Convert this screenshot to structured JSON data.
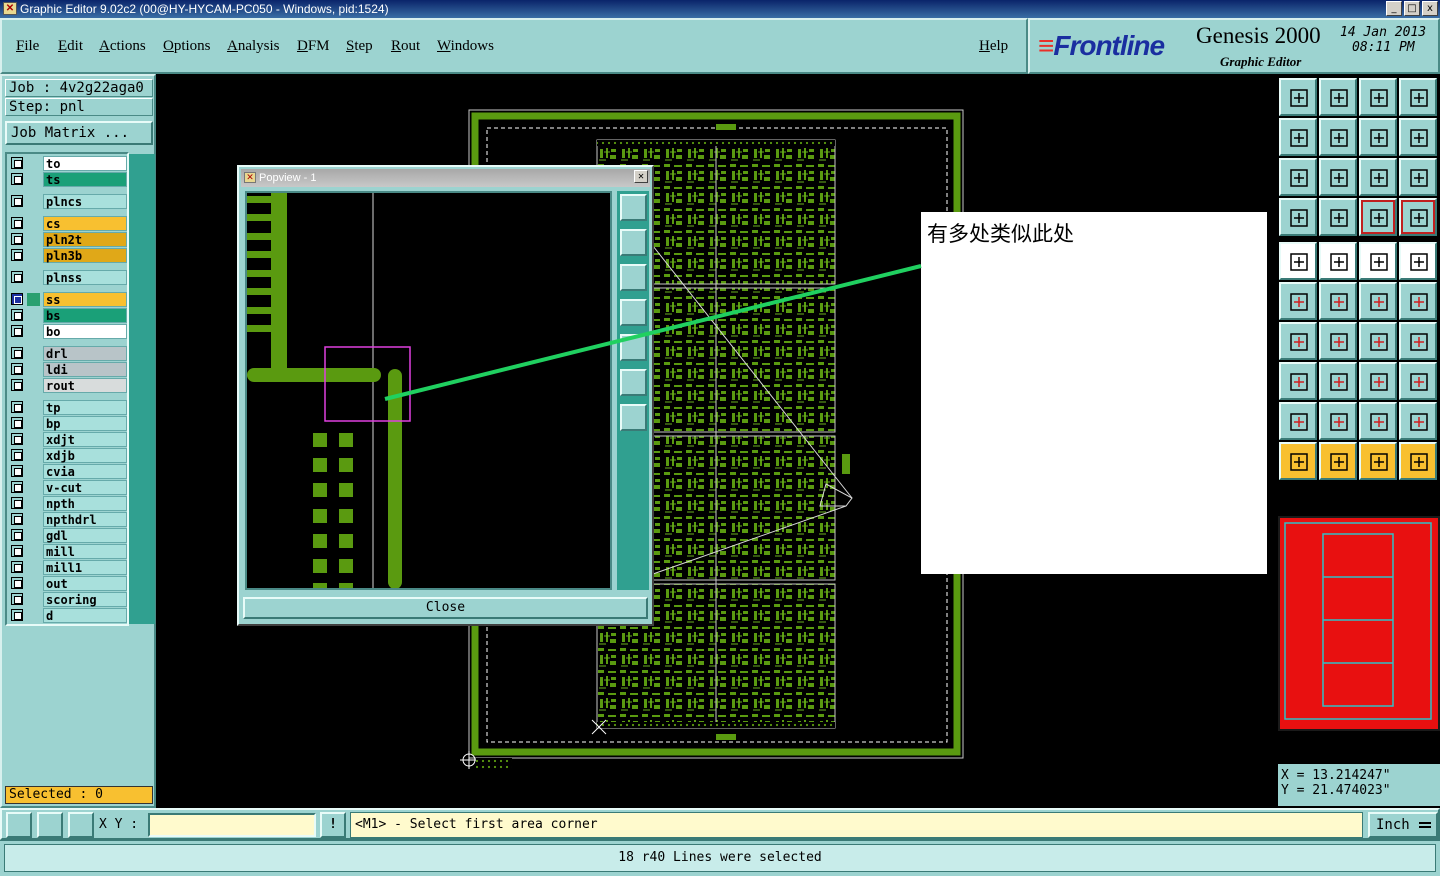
{
  "window": {
    "title": "Graphic Editor 9.02c2 (00@HY-HYCAM-PC050 - Windows, pid:1524)",
    "buttons": [
      "_",
      "□",
      "x"
    ]
  },
  "menu": {
    "items": [
      "File",
      "Edit",
      "Actions",
      "Options",
      "Analysis",
      "DFM",
      "Step",
      "Rout",
      "Windows"
    ],
    "help": "Help"
  },
  "brand": {
    "logo": "Frontline",
    "product": "Genesis 2000",
    "subtitle": "Graphic Editor",
    "date": "14 Jan 2013",
    "time": "08:11 PM"
  },
  "job": {
    "job_label": "Job : 4v2g22aga0",
    "step_label": "Step: pnl",
    "matrix_button": "Job Matrix ..."
  },
  "layers": [
    {
      "name": "to",
      "color": "#ffffff"
    },
    {
      "name": "ts",
      "color": "#1aa078"
    },
    {
      "name": "plncs",
      "color": "#a8e0dc"
    },
    {
      "name": "cs",
      "color": "#f8c030"
    },
    {
      "name": "pln2t",
      "color": "#e0a818"
    },
    {
      "name": "pln3b",
      "color": "#e0a818"
    },
    {
      "name": "plnss",
      "color": "#a8e0dc"
    },
    {
      "name": "ss",
      "color": "#f8c030"
    },
    {
      "name": "bs",
      "color": "#1aa078"
    },
    {
      "name": "bo",
      "color": "#ffffff"
    },
    {
      "name": "drl",
      "color": "#b8c4c8"
    },
    {
      "name": "ldi",
      "color": "#b8c4c8"
    },
    {
      "name": "rout",
      "color": "#d8dcdc"
    },
    {
      "name": "tp",
      "color": "#a8e0dc"
    },
    {
      "name": "bp",
      "color": "#a8e0dc"
    },
    {
      "name": "xdjt",
      "color": "#a8e0dc"
    },
    {
      "name": "xdjb",
      "color": "#a8e0dc"
    },
    {
      "name": "cvia",
      "color": "#a8e0dc"
    },
    {
      "name": "v-cut",
      "color": "#a8e0dc"
    },
    {
      "name": "npth",
      "color": "#a8e0dc"
    },
    {
      "name": "npthdrl",
      "color": "#a8e0dc"
    },
    {
      "name": "gdl",
      "color": "#a8e0dc"
    },
    {
      "name": "mill",
      "color": "#a8e0dc"
    },
    {
      "name": "mill1",
      "color": "#a8e0dc"
    },
    {
      "name": "out",
      "color": "#a8e0dc"
    },
    {
      "name": "scoring",
      "color": "#a8e0dc"
    },
    {
      "name": "d",
      "color": "#a8e0dc"
    }
  ],
  "selected": "Selected : 0",
  "popview": {
    "title": "Popview - 1",
    "close_button": "Close"
  },
  "annotation": "有多处类似此处",
  "coords": {
    "x": "X = 13.214247\"",
    "y": "Y = 21.474023\""
  },
  "command": {
    "xy_label": "X Y :",
    "xy_value": "",
    "bang": "!",
    "prompt": "<M1> - Select first area corner",
    "unit": "Inch"
  },
  "status": "18 r40 Lines were selected",
  "colors": {
    "panel": "#9cd3d0",
    "trace": "#5a9a10",
    "highlight": "#20d060",
    "minimap": "#e81010",
    "selected_bg": "#f8c030"
  }
}
